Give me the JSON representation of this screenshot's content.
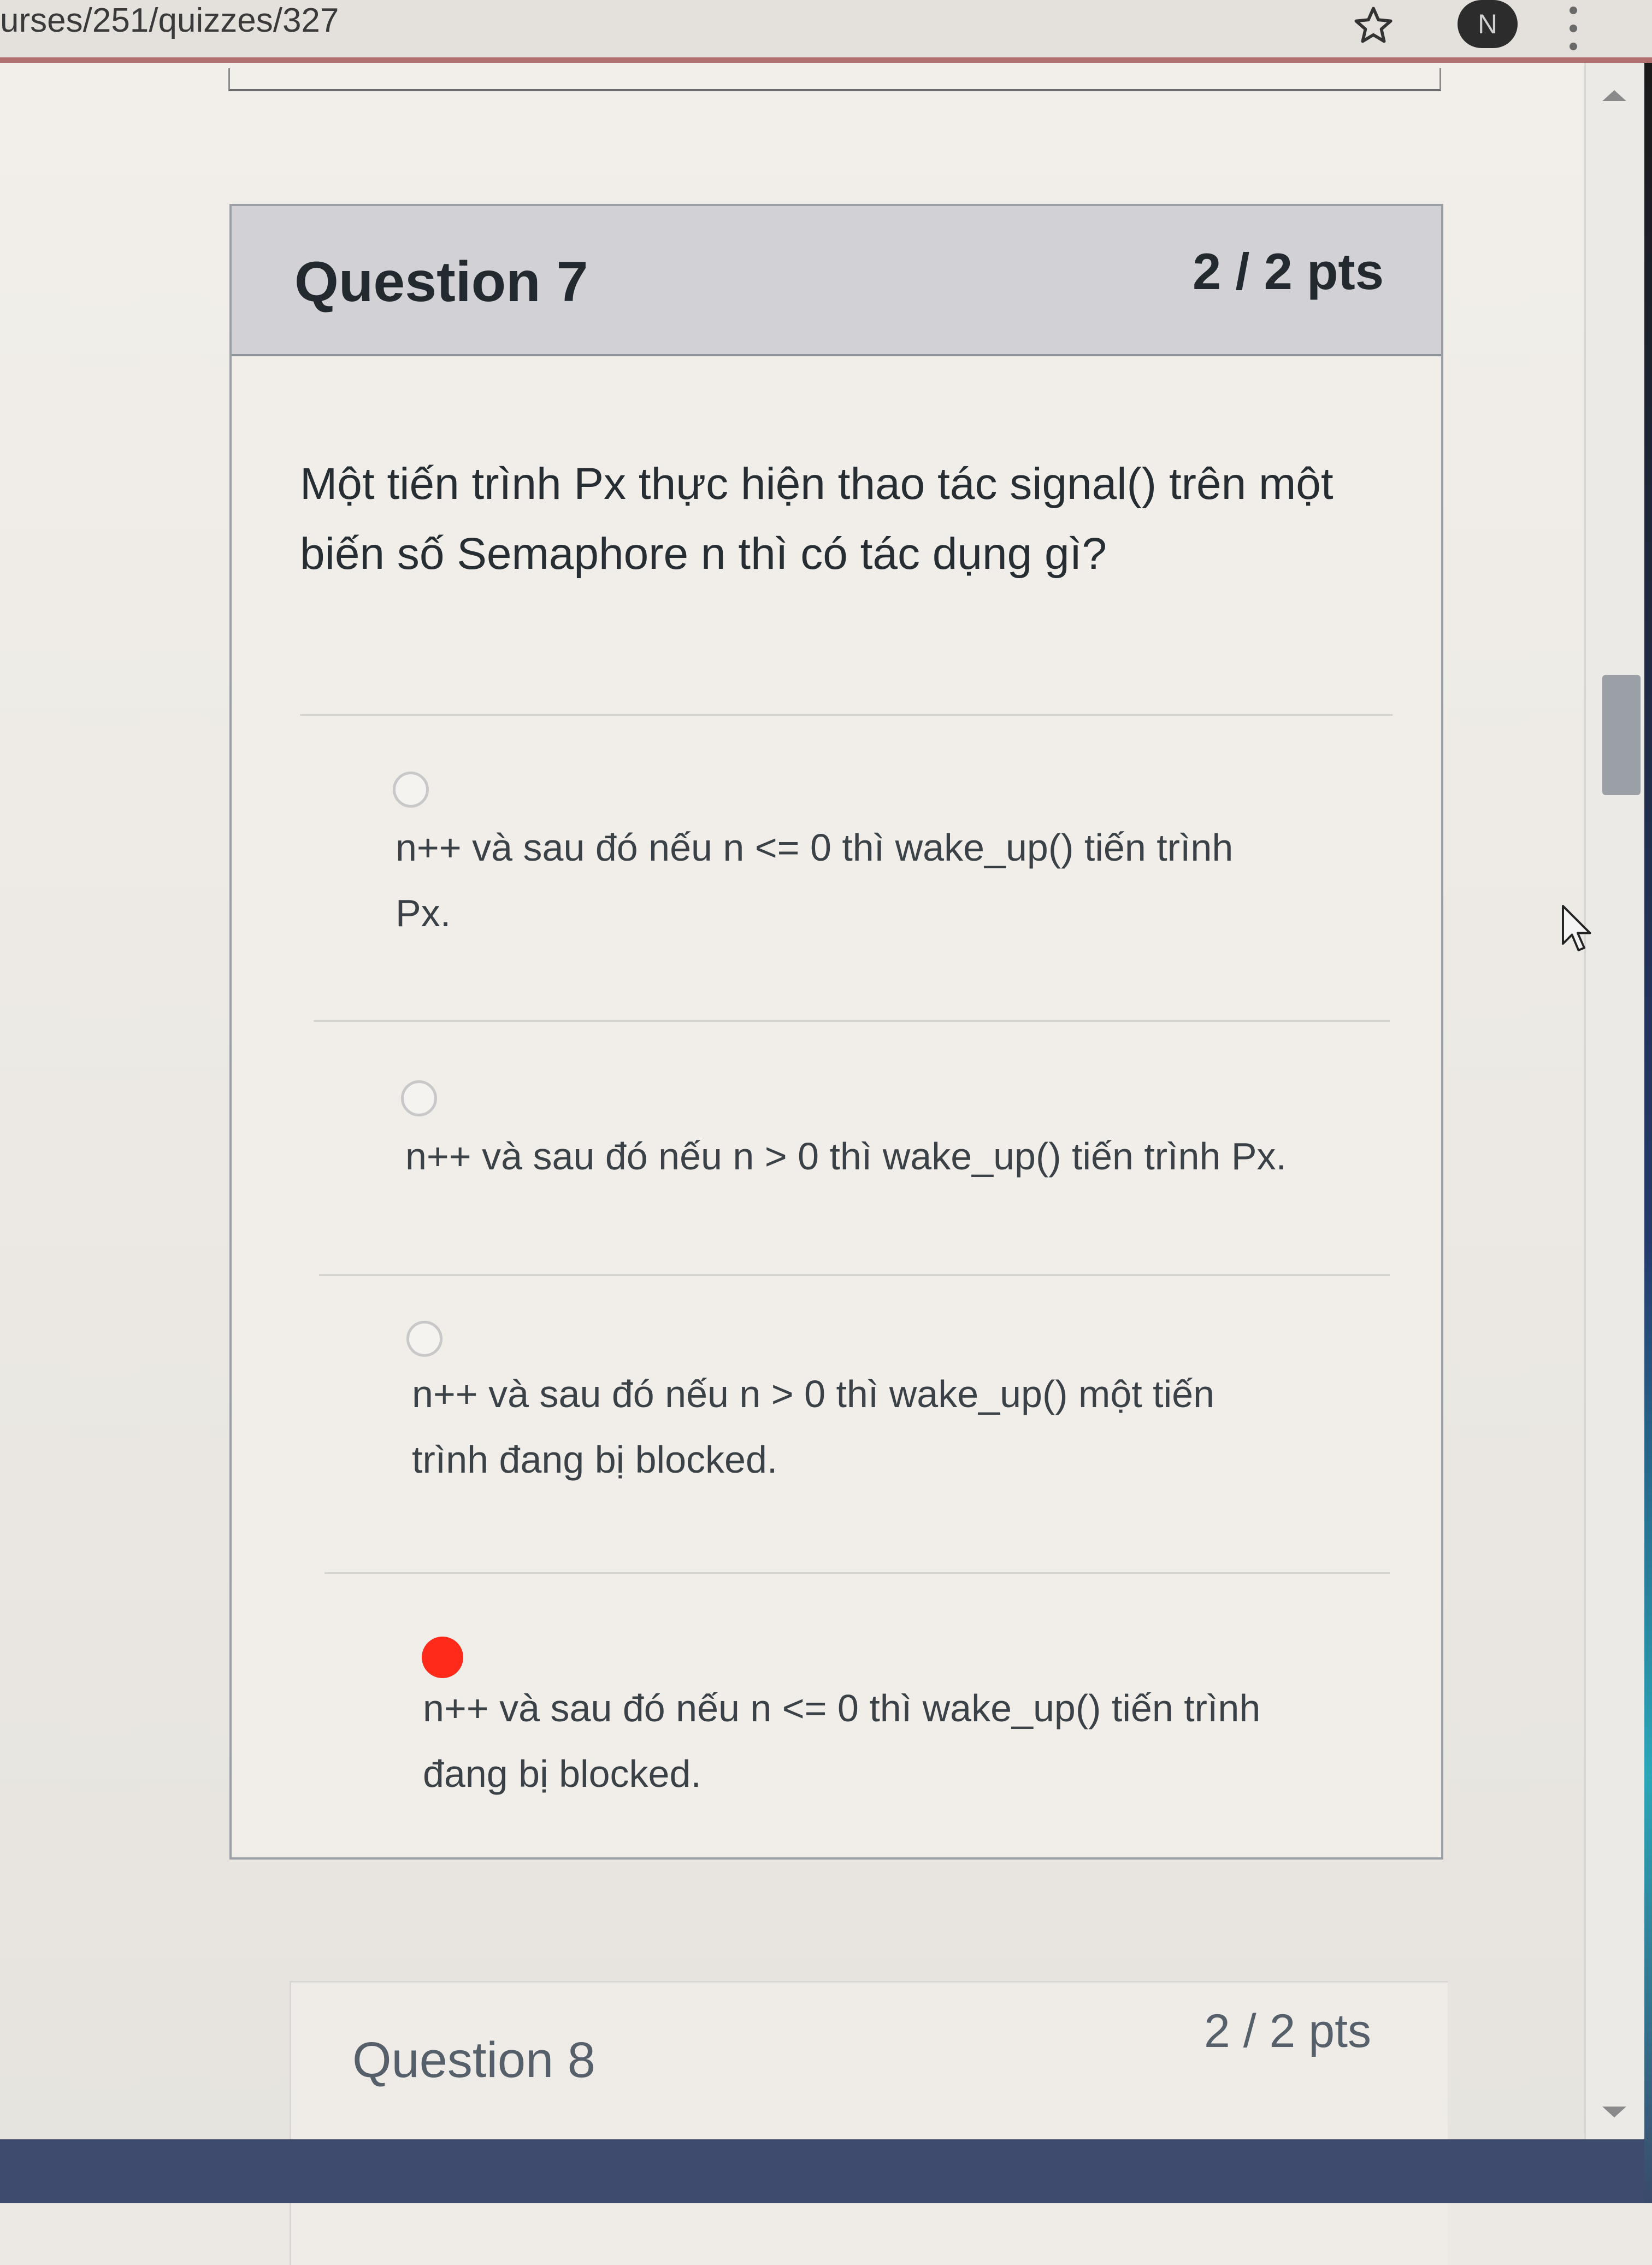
{
  "browser": {
    "url_fragment": "urses/251/quizzes/327",
    "profile_initial": "N",
    "icons": [
      "star-icon",
      "kebab-menu-icon"
    ]
  },
  "question": {
    "title": "Question 7",
    "points": "2 / 2 pts",
    "text": "Một tiến trình Px thực hiện thao tác signal() trên một biến số Semaphore n thì có tác dụng gì?",
    "answers": [
      {
        "line1": "n++ và sau đó nếu n <= 0 thì wake_up() tiến trình",
        "line2": "Px.",
        "selected": false
      },
      {
        "line1": "n++ và sau đó nếu n > 0 thì wake_up() tiến trình Px.",
        "line2": "",
        "selected": false
      },
      {
        "line1": "n++ và sau đó nếu n > 0 thì wake_up() một tiến",
        "line2": "trình đang bị blocked.",
        "selected": false
      },
      {
        "line1": "n++ và sau đó nếu n <= 0 thì wake_up() tiến trình",
        "line2": "đang bị blocked.",
        "selected": true
      }
    ],
    "selected_color": "#ff2a1a"
  },
  "next_question": {
    "title": "Question 8",
    "points": "2 / 2 pts"
  }
}
